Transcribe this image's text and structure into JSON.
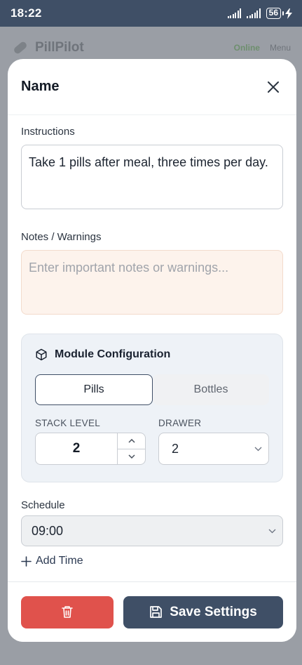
{
  "status_bar": {
    "time": "18:22",
    "battery": "56"
  },
  "background": {
    "app_name": "PillPilot",
    "status": "Online",
    "menu": "Menu"
  },
  "modal": {
    "title": "Name",
    "instructions": {
      "label": "Instructions",
      "value": "Take 1 pills after meal, three times per day."
    },
    "notes": {
      "label": "Notes / Warnings",
      "placeholder": "Enter important notes or warnings..."
    },
    "module": {
      "title": "Module Configuration",
      "tabs": [
        {
          "label": "Pills",
          "active": true
        },
        {
          "label": "Bottles",
          "active": false
        }
      ],
      "stack_level": {
        "label": "STACK LEVEL",
        "value": "2"
      },
      "drawer": {
        "label": "DRAWER",
        "value": "2"
      }
    },
    "schedule": {
      "label": "Schedule",
      "times": [
        "09:00"
      ],
      "add_time": "Add Time"
    },
    "footer": {
      "save_label": "Save Settings"
    }
  },
  "colors": {
    "primary": "#3f4f66",
    "danger": "#e0524c",
    "notes_bg": "#fdf3ec",
    "module_bg": "#eef2f7"
  }
}
